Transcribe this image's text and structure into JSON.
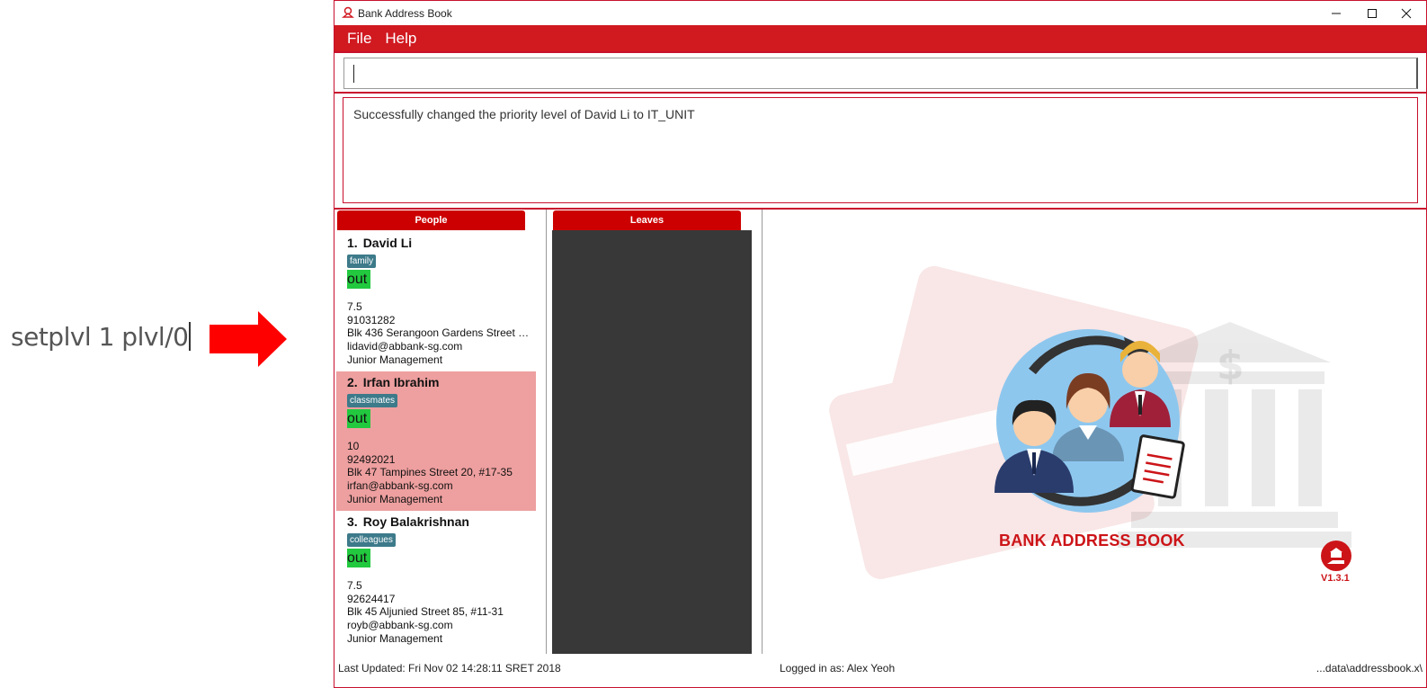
{
  "annotation": {
    "command_text": "setplvl 1 plvl/0"
  },
  "window": {
    "title": "Bank Address Book"
  },
  "menu": {
    "file": "File",
    "help": "Help"
  },
  "command_box": {
    "value": ""
  },
  "result": {
    "message": "Successfully changed the priority level of David Li to IT_UNIT"
  },
  "panels": {
    "people_tab": "People",
    "leaves_tab": "Leaves"
  },
  "people": [
    {
      "index": "1.",
      "name": "David Li",
      "tag": "family",
      "status": "out",
      "working_rate": "7.5",
      "phone": "91031282",
      "address": "Blk 436 Serangoon Gardens Street 26, ...",
      "email": "lidavid@abbank-sg.com",
      "department": "Junior Management"
    },
    {
      "index": "2.",
      "name": "Irfan Ibrahim",
      "tag": "classmates",
      "status": "out",
      "working_rate": "10",
      "phone": "92492021",
      "address": "Blk 47 Tampines Street 20, #17-35",
      "email": "irfan@abbank-sg.com",
      "department": "Junior Management"
    },
    {
      "index": "3.",
      "name": "Roy Balakrishnan",
      "tag": "colleagues",
      "status": "out",
      "working_rate": "7.5",
      "phone": "92624417",
      "address": "Blk 45 Aljunied Street 85, #11-31",
      "email": "royb@abbank-sg.com",
      "department": "Junior Management"
    }
  ],
  "splash": {
    "title": "BANK ADDRESS BOOK",
    "version": "V1.3.1"
  },
  "statusbar": {
    "last_updated": "Last Updated: Fri Nov 02 14:28:11 SRET 2018",
    "logged_in": "Logged in as: Alex Yeoh",
    "file_path": "...data\\addressbook.x\\"
  },
  "colors": {
    "brand_red": "#d11920",
    "selected_row": "#ee9f9f",
    "status_green": "#22c93f",
    "tag_teal": "#3d7a8a"
  }
}
